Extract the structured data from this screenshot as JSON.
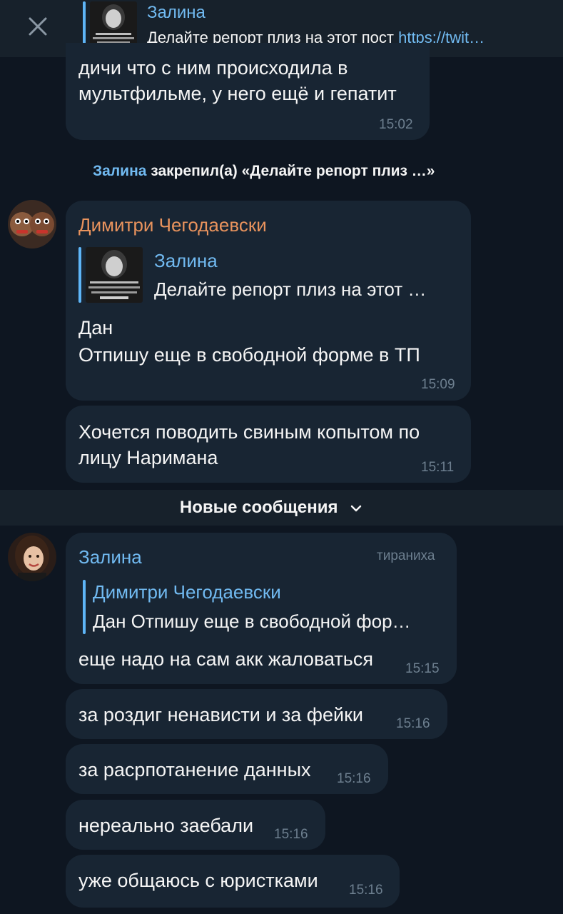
{
  "pinned": {
    "name": "Залина",
    "text": "Делайте репорт плиз на этот пост ",
    "link": "https://twit…"
  },
  "messages": {
    "m0": {
      "text_line1": "дичи что с ним происходила в",
      "text_line2": "мультфильме, у него ещё и гепатит",
      "time": "15:02"
    },
    "service": {
      "who": "Залина",
      "action": " закрепил(а) «Делайте репорт плиз …»"
    },
    "m1": {
      "sender": "Димитри Чегодаевски",
      "reply_name": "Залина",
      "reply_text": "Делайте репорт плиз на этот …",
      "text_line1": "Дан",
      "text_line2": "Отпишу еще в свободной форме в ТП",
      "time": "15:09"
    },
    "m2": {
      "text_line1": "Хочется поводить свиным копытом по",
      "text_line2": "лицу Наримана",
      "time": "15:11"
    },
    "new_messages": "Новые сообщения",
    "m3": {
      "sender": "Залина",
      "badge": "тираниха",
      "reply_name": "Димитри Чегодаевски",
      "reply_text": "Дан Отпишу еще в свободной фор…",
      "text": "еще надо на сам акк жаловаться",
      "time": "15:15"
    },
    "m4": {
      "text": "за роздиг ненависти и за фейки",
      "time": "15:16"
    },
    "m5": {
      "text": "за расрпотанение данных",
      "time": "15:16"
    },
    "m6": {
      "text": "нереально заебали",
      "time": "15:16"
    },
    "m7": {
      "text": "уже общаюсь с юристками",
      "time": "15:16"
    }
  },
  "colors": {
    "background": "#0e1621",
    "bubble": "#182533",
    "accent": "#5eb5f7",
    "link": "#71baf1",
    "orange_name": "#e9935d",
    "timestamp": "#6d7f8f"
  },
  "icons": [
    "close-icon",
    "chevron-down-icon"
  ]
}
